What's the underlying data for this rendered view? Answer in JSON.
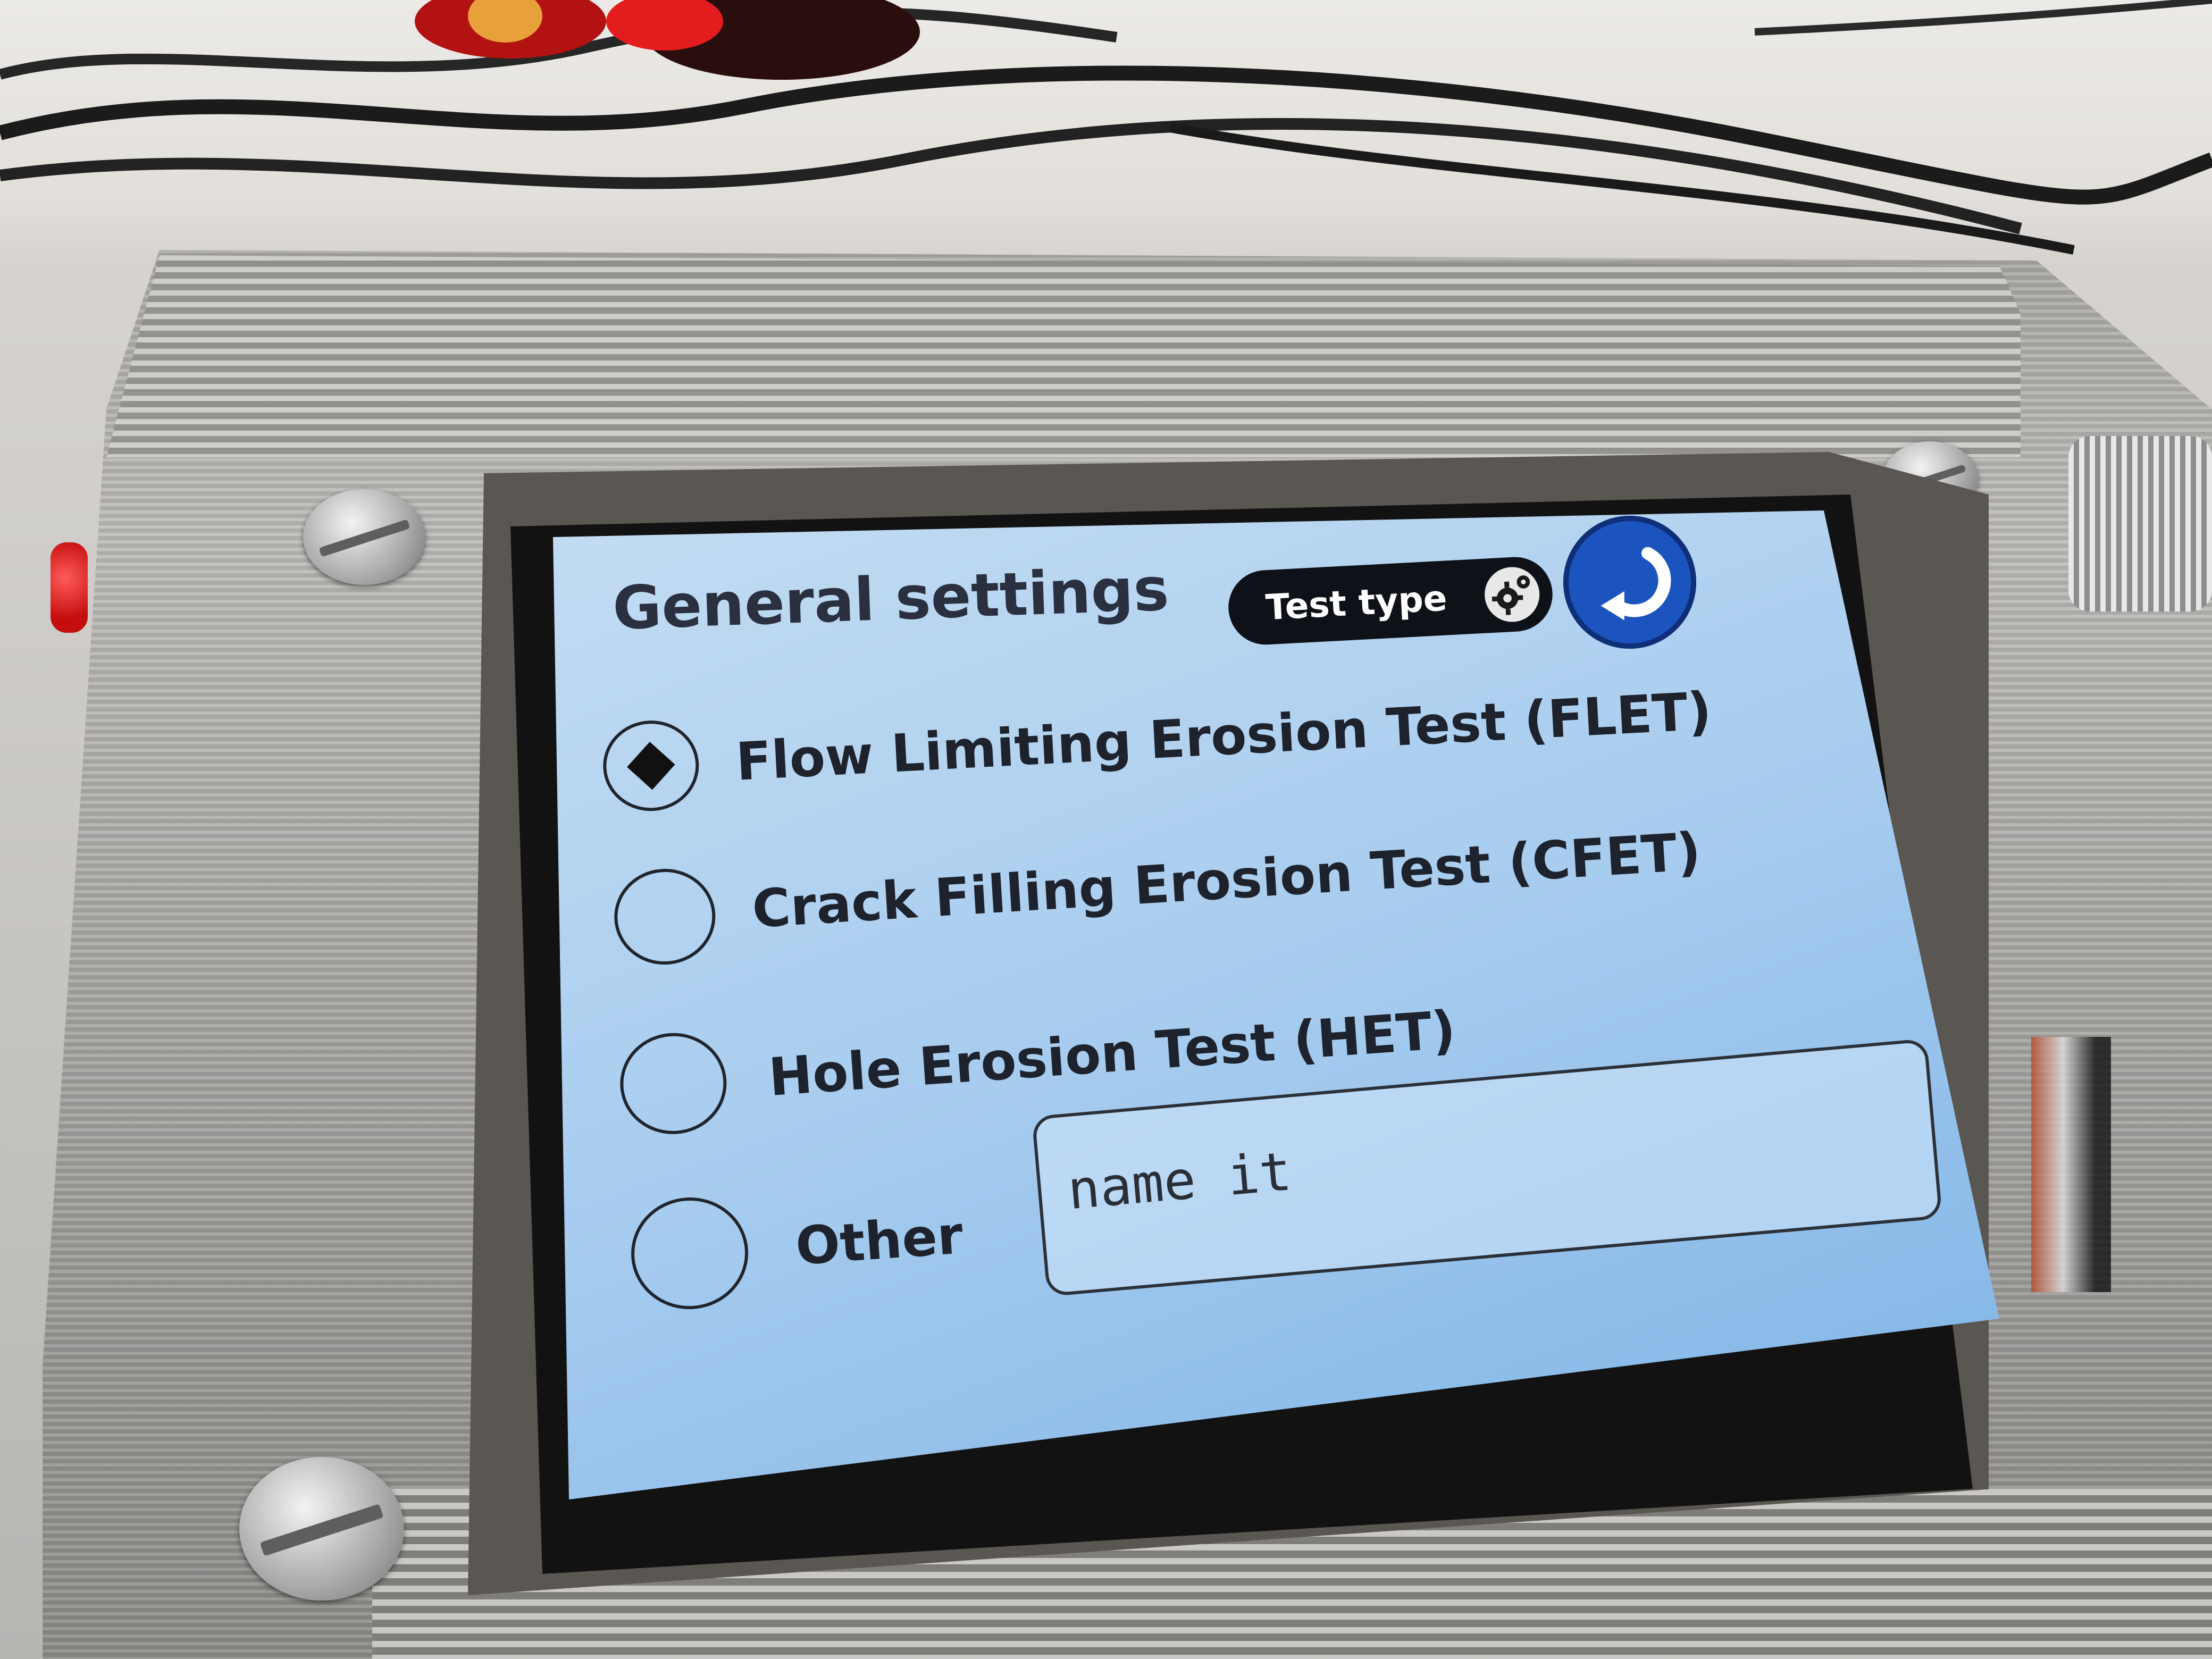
{
  "screen": {
    "title": "General settings",
    "test_type_button": "Test type",
    "options": [
      {
        "label": "Flow Limiting Erosion Test (FLET)",
        "selected": true
      },
      {
        "label": "Crack Filling Erosion Test (CFET)",
        "selected": false
      },
      {
        "label": "Hole Erosion Test (HET)",
        "selected": false
      },
      {
        "label": "Other",
        "selected": false
      }
    ],
    "other_name_value": "name it"
  },
  "colors": {
    "screen_background": "#a9cdef",
    "back_button": "#1c54bf",
    "test_type_pill": "#0e1117"
  },
  "icons": {
    "test_type": "gear-icon",
    "back": "back-arrow-icon"
  }
}
